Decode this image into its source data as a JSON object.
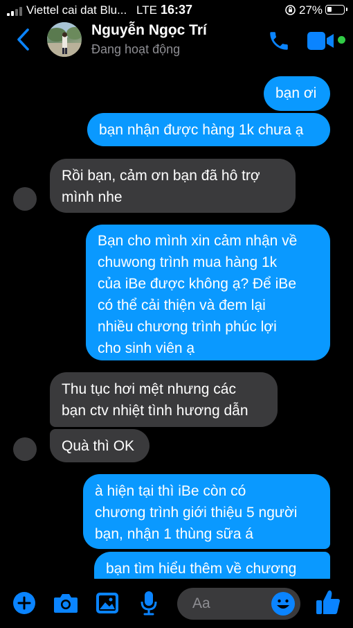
{
  "status_bar": {
    "carrier": "Viettel cai dat Blu...",
    "network": "LTE",
    "time": "16:37",
    "battery_percent": "27%",
    "battery_level": 0.27
  },
  "header": {
    "contact_name": "Nguyễn Ngọc Trí",
    "contact_status": "Đang hoạt động",
    "accent_color": "#0a84ff",
    "online_color": "#31cc46"
  },
  "messages": [
    {
      "side": "out",
      "text": "bạn ơi"
    },
    {
      "side": "out",
      "text": "bạn nhận được hàng 1k chưa ạ"
    },
    {
      "side": "in",
      "lines": [
        "Rồi bạn,  cảm ơn bạn đã hô trợ",
        "mình nhe"
      ]
    },
    {
      "side": "out",
      "lines": [
        "Bạn cho mình xin cảm nhận về",
        "chuwong trình mua hàng 1k",
        "của iBe được không ạ? Để iBe",
        "có thể cải thiện và đem lại",
        "nhiều chương trình phúc lợi",
        "cho sinh viên ạ"
      ]
    },
    {
      "side": "in",
      "lines": [
        "Thu tục hơi mệt nhưng các",
        "bạn ctv nhiệt tình hương dẫn"
      ]
    },
    {
      "side": "in",
      "text": "Quà thì OK"
    },
    {
      "side": "out",
      "lines": [
        "à hiện tại thì iBe còn có",
        "chương trình giới thiệu 5 người",
        "bạn, nhận 1 thùng sữa á"
      ]
    },
    {
      "side": "out",
      "text": "bạn tìm hiểu thêm về chương"
    }
  ],
  "composer": {
    "placeholder": "Aa",
    "icons": [
      "add-icon",
      "camera-icon",
      "gallery-icon",
      "microphone-icon",
      "emoji-icon",
      "thumbs-up-icon"
    ]
  },
  "colors": {
    "outgoing_bubble": "#0a99ff",
    "incoming_bubble": "#3a3a3c",
    "background": "#000000"
  }
}
